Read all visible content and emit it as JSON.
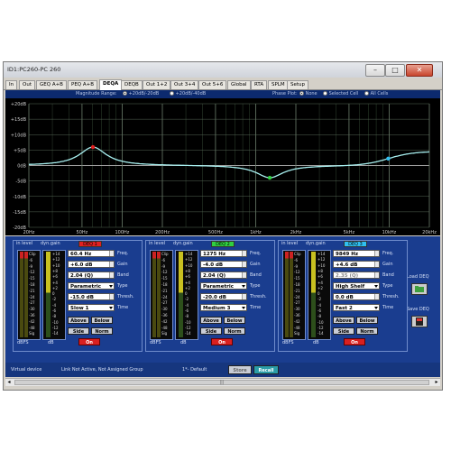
{
  "window": {
    "title": "ID1:PC260-PC 260",
    "min_glyph": "–",
    "max_glyph": "□",
    "close_glyph": "✕"
  },
  "tabs": [
    {
      "label": "In",
      "active": false
    },
    {
      "label": "Out",
      "active": false
    },
    {
      "label": "GEQ A+B",
      "active": false
    },
    {
      "label": "PEQ A+B",
      "active": false
    },
    {
      "label": "DEQA",
      "active": true
    },
    {
      "label": "DEQB",
      "active": false
    },
    {
      "label": "Out 1+2",
      "active": false
    },
    {
      "label": "Out 3+4",
      "active": false
    },
    {
      "label": "Out 5+6",
      "active": false
    },
    {
      "label": "Global",
      "active": false
    },
    {
      "label": "RTA",
      "active": false
    },
    {
      "label": "SPLM",
      "active": false
    },
    {
      "label": "Setup",
      "active": false
    }
  ],
  "options": {
    "magnitude_label": "Magnitude Range:",
    "magnitude_options": [
      {
        "label": "+20dB/-20dB",
        "selected": true
      },
      {
        "label": "+20dB/-40dB",
        "selected": false
      }
    ],
    "phase_label": "Phase Plot:",
    "phase_options": [
      {
        "label": "None",
        "selected": true
      },
      {
        "label": "Selected Cell",
        "selected": false
      },
      {
        "label": "All Cells",
        "selected": false
      }
    ]
  },
  "graph": {
    "y_ticks": [
      "+20dB",
      "+15dB",
      "+10dB",
      "+5dB",
      "0dB",
      "-5dB",
      "-10dB",
      "-15dB",
      "-20dB"
    ],
    "x_ticks": [
      "20Hz",
      "50Hz",
      "100Hz",
      "200Hz",
      "500Hz",
      "1kHz",
      "2kHz",
      "5kHz",
      "10kHz",
      "20kHz"
    ],
    "curve_color": "#a8f0f0",
    "markers": [
      {
        "freq_hz": 60.4,
        "gain_db": 6.0,
        "color": "#e02020"
      },
      {
        "freq_hz": 1275,
        "gain_db": -4.0,
        "color": "#30d040"
      },
      {
        "freq_hz": 9849,
        "gain_db": 4.6,
        "color": "#30c0f0"
      }
    ]
  },
  "bands": [
    {
      "in_level_label": "in level",
      "dyn_gain_label": "dyn.gain",
      "deq_label": "DEQ 1",
      "deq_color": "#e02020",
      "freq": "60.4 Hz",
      "gain": "+6.0 dB",
      "band": "2.04 (Q)",
      "type": "Parametric",
      "thresh": "-15.0 dB",
      "time": "Slow 1",
      "freq_label": "Freq.",
      "gain_label": "Gain",
      "band_label": "Band",
      "type_label": "Type",
      "thresh_label": "Thresh.",
      "time_label": "Time",
      "above": "Above",
      "below": "Below",
      "side": "Side",
      "norm": "Norm",
      "on": "On",
      "dbfs": "dBFS",
      "db": "dB",
      "band_disabled": false
    },
    {
      "in_level_label": "in level",
      "dyn_gain_label": "dyn.gain",
      "deq_label": "DEQ 2",
      "deq_color": "#30d040",
      "freq": "1275 Hz",
      "gain": "-4.0 dB",
      "band": "2.04 (Q)",
      "type": "Parametric",
      "thresh": "-20.0 dB",
      "time": "Medium 3",
      "freq_label": "Freq.",
      "gain_label": "Gain",
      "band_label": "Band",
      "type_label": "Type",
      "thresh_label": "Thresh.",
      "time_label": "Time",
      "above": "Above",
      "below": "Below",
      "side": "Side",
      "norm": "Norm",
      "on": "On",
      "dbfs": "dBFS",
      "db": "dB",
      "band_disabled": false
    },
    {
      "in_level_label": "in level",
      "dyn_gain_label": "dyn.gain",
      "deq_label": "DEQ 3",
      "deq_color": "#30c0f0",
      "freq": "9849 Hz",
      "gain": "+4.6 dB",
      "band": "2.35 (Q)",
      "type": "High Shelf",
      "thresh": "0.0 dB",
      "time": "Fast 2",
      "freq_label": "Freq.",
      "gain_label": "Gain",
      "band_label": "Band",
      "type_label": "Type",
      "thresh_label": "Thresh.",
      "time_label": "Time",
      "above": "Above",
      "below": "Below",
      "side": "Side",
      "norm": "Norm",
      "on": "On",
      "dbfs": "dBFS",
      "db": "dB",
      "band_disabled": true
    }
  ],
  "meter_ticks": {
    "in_level": [
      "Clip",
      "-6",
      "-9",
      "-12",
      "-15",
      "-18",
      "-21",
      "-24",
      "-27",
      "-30",
      "-36",
      "-42",
      "-48",
      "Sig"
    ],
    "dyn_gain": [
      "+14",
      "+12",
      "+10",
      "+8",
      "+6",
      "+4",
      "+2",
      "0",
      "-2",
      "-4",
      "-6",
      "-8",
      "-10",
      "-12",
      "-14"
    ]
  },
  "side_controls": {
    "load": "Load DEQ",
    "save": "Save DEQ"
  },
  "status": {
    "device": "Virtual device",
    "link": "Link Not Active,  Not Assigned Group",
    "preset": "1*- Default",
    "store": "Store",
    "recall": "Recall"
  },
  "scroll": {
    "glyph": "|||"
  }
}
